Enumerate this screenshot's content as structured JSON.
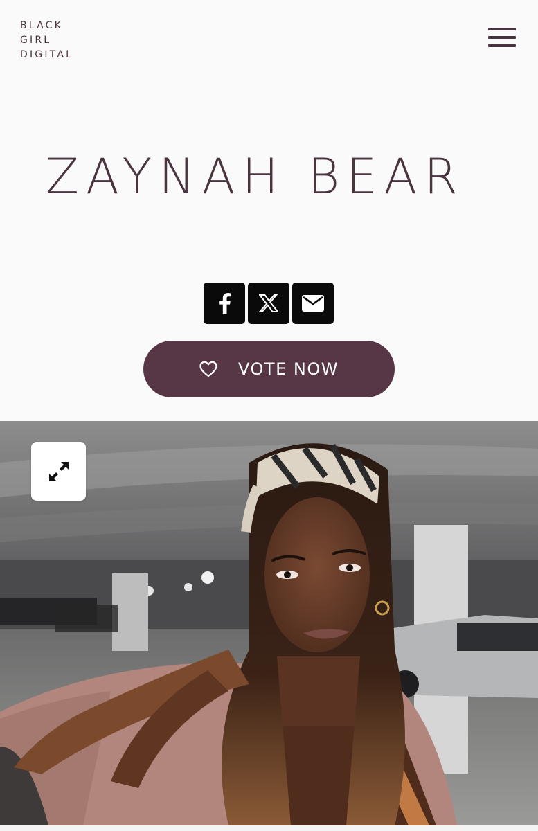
{
  "header": {
    "logo_lines": [
      "BLACK",
      "GIRL",
      "DIGITAL"
    ],
    "menu_icon": "hamburger-menu-icon"
  },
  "profile": {
    "name": "ZAYNAH BEAR"
  },
  "share": {
    "buttons": [
      {
        "icon": "facebook-icon"
      },
      {
        "icon": "x-twitter-icon"
      },
      {
        "icon": "email-icon"
      }
    ]
  },
  "vote": {
    "label": "VOTE NOW",
    "icon": "heart-icon"
  },
  "photo": {
    "expand_icon": "expand-arrows-icon"
  },
  "colors": {
    "brand_plum": "#573645",
    "text_plum": "#4a3440",
    "share_black": "#0a0a0a",
    "background": "#fafafa"
  }
}
